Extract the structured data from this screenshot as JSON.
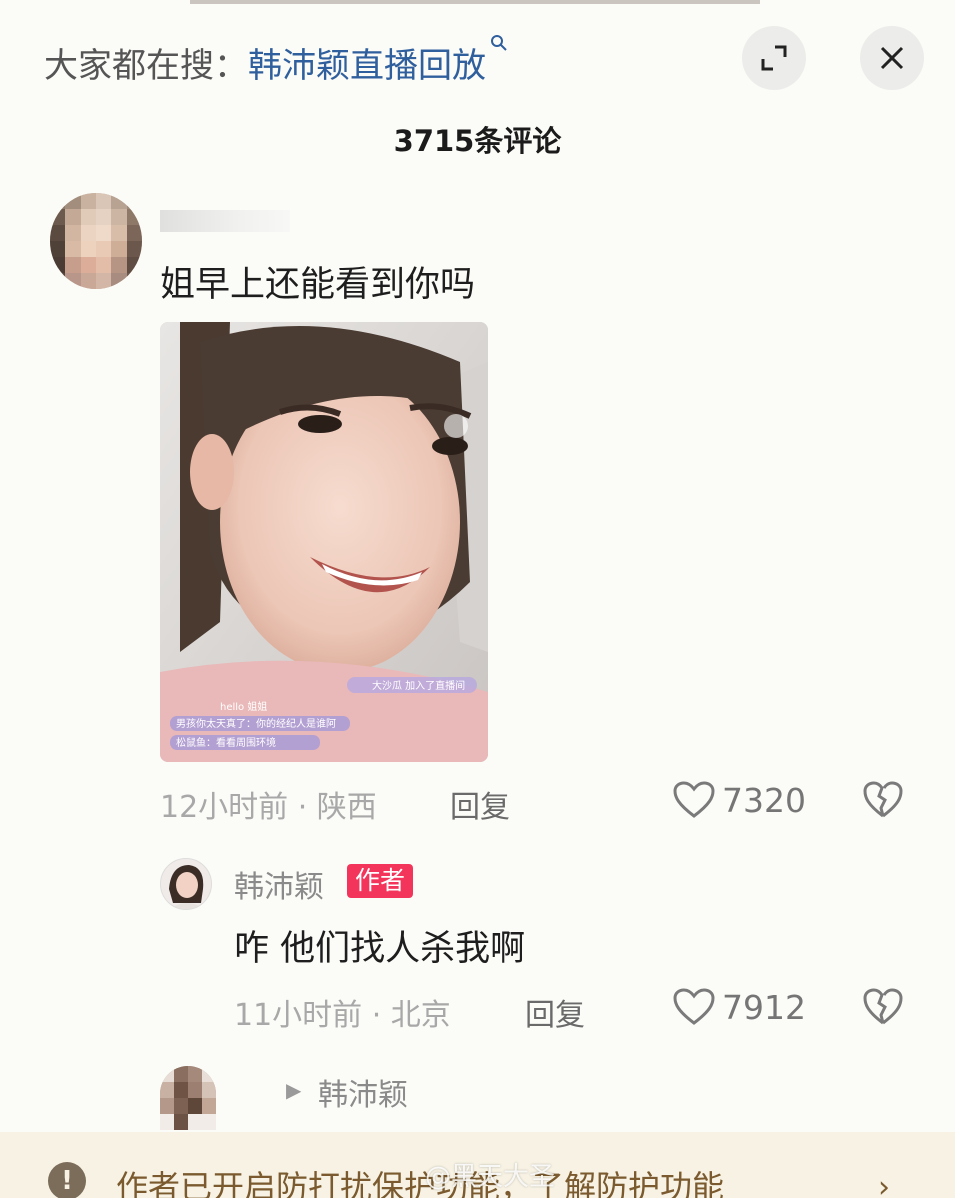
{
  "header": {
    "search_prefix": "大家都在搜：",
    "search_term": "韩沛颖直播回放",
    "comment_count": "3715条评论"
  },
  "icons": {
    "expand": "expand-icon",
    "close": "close-icon",
    "search": "search-icon",
    "like": "heart-outline-icon",
    "dislike": "broken-heart-icon"
  },
  "comments": [
    {
      "text": "姐早上还能看到你吗",
      "time": "12小时前",
      "location": "陕西",
      "reply_label": "回复",
      "likes": "7320"
    }
  ],
  "livestream": {
    "join_text": "大沙瓜 加入了直播间",
    "chat": [
      "hello 姐姐",
      "男孩你太天真了：你的经纪人是谁阿",
      "松鼠鱼：看看周围环境"
    ]
  },
  "reply": {
    "username": "韩沛颖",
    "badge": "作者",
    "text": "咋 他们找人杀我啊",
    "time": "11小时前",
    "location": "北京",
    "reply_label": "回复",
    "likes": "7912"
  },
  "third": {
    "reply_to": "韩沛颖"
  },
  "banner": {
    "icon": "!",
    "text": "作者已开启防打扰保护功能，了解防护功能",
    "watermark": "@黑天大圣"
  },
  "colors": {
    "link": "#2f5f9d",
    "badge": "#f4355b",
    "banner_bg": "#f7f2e3",
    "banner_text": "#7a5a2e"
  }
}
